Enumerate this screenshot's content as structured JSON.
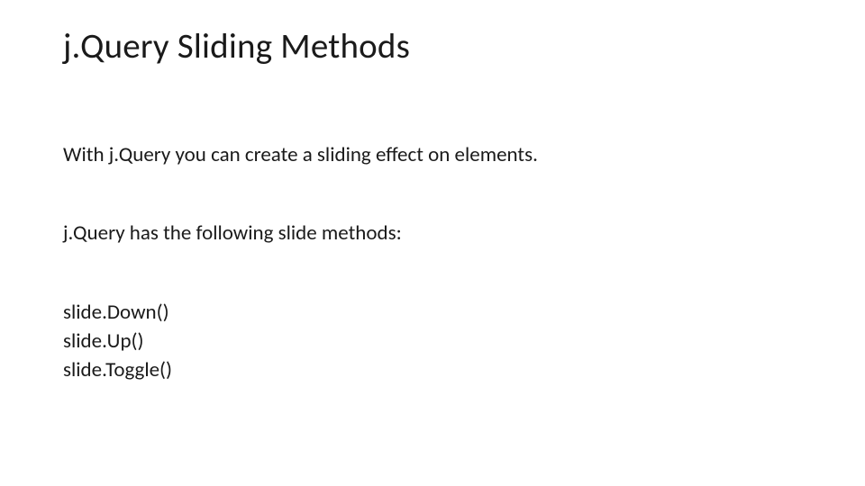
{
  "slide": {
    "title": "j.Query Sliding Methods",
    "paragraph1": "With j.Query you can create a sliding effect on elements.",
    "paragraph2": "j.Query has the following slide methods:",
    "methods": [
      "slide.Down()",
      "slide.Up()",
      "slide.Toggle()"
    ]
  }
}
